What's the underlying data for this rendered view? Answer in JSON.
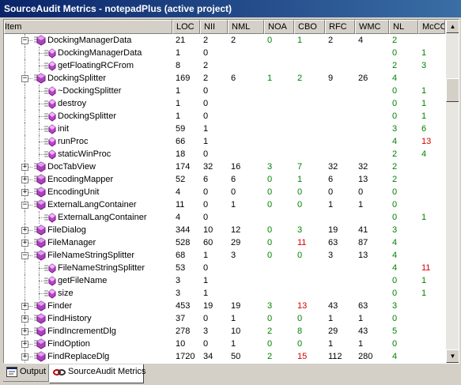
{
  "window": {
    "title": "SourceAudit Metrics - notepadPlus (active project)"
  },
  "columns": [
    "Item",
    "LOC",
    "NII",
    "NML",
    "NOA",
    "CBO",
    "RFC",
    "WMC",
    "NL",
    "McCC"
  ],
  "colors": {
    "good": "#008000",
    "bad": "#d00000",
    "title_start": "#0a246a",
    "title_end": "#3a6ea5"
  },
  "rows": [
    {
      "name": "DockingManagerData",
      "kind": "class",
      "expander": "-",
      "loc": "21",
      "nii": "2",
      "nml": "2",
      "noa": "0",
      "cbo": "1",
      "rfc": "2",
      "wmc": "4",
      "nl": "2",
      "mccc": ""
    },
    {
      "name": "DockingManagerData",
      "kind": "method",
      "expander": "",
      "loc": "1",
      "nii": "0",
      "nml": "",
      "noa": "",
      "cbo": "",
      "rfc": "",
      "wmc": "",
      "nl": "0",
      "mccc": "1"
    },
    {
      "name": "getFloatingRCFrom",
      "kind": "method",
      "expander": "",
      "loc": "8",
      "nii": "2",
      "nml": "",
      "noa": "",
      "cbo": "",
      "rfc": "",
      "wmc": "",
      "nl": "2",
      "mccc": "3"
    },
    {
      "name": "DockingSplitter",
      "kind": "class",
      "expander": "-",
      "loc": "169",
      "nii": "2",
      "nml": "6",
      "noa": "1",
      "cbo": "2",
      "rfc": "9",
      "wmc": "26",
      "nl": "4",
      "mccc": ""
    },
    {
      "name": "~DockingSplitter",
      "kind": "method",
      "expander": "",
      "loc": "1",
      "nii": "0",
      "nml": "",
      "noa": "",
      "cbo": "",
      "rfc": "",
      "wmc": "",
      "nl": "0",
      "mccc": "1"
    },
    {
      "name": "destroy",
      "kind": "method",
      "expander": "",
      "loc": "1",
      "nii": "0",
      "nml": "",
      "noa": "",
      "cbo": "",
      "rfc": "",
      "wmc": "",
      "nl": "0",
      "mccc": "1"
    },
    {
      "name": "DockingSplitter",
      "kind": "method",
      "expander": "",
      "loc": "1",
      "nii": "0",
      "nml": "",
      "noa": "",
      "cbo": "",
      "rfc": "",
      "wmc": "",
      "nl": "0",
      "mccc": "1"
    },
    {
      "name": "init",
      "kind": "method",
      "expander": "",
      "loc": "59",
      "nii": "1",
      "nml": "",
      "noa": "",
      "cbo": "",
      "rfc": "",
      "wmc": "",
      "nl": "3",
      "mccc": "6"
    },
    {
      "name": "runProc",
      "kind": "method",
      "expander": "",
      "loc": "66",
      "nii": "1",
      "nml": "",
      "noa": "",
      "cbo": "",
      "rfc": "",
      "wmc": "",
      "nl": "4",
      "mccc": "13"
    },
    {
      "name": "staticWinProc",
      "kind": "method",
      "expander": "",
      "loc": "18",
      "nii": "0",
      "nml": "",
      "noa": "",
      "cbo": "",
      "rfc": "",
      "wmc": "",
      "nl": "2",
      "mccc": "4"
    },
    {
      "name": "DocTabView",
      "kind": "class",
      "expander": "+",
      "loc": "174",
      "nii": "32",
      "nml": "16",
      "noa": "3",
      "cbo": "7",
      "rfc": "32",
      "wmc": "32",
      "nl": "2",
      "mccc": ""
    },
    {
      "name": "EncodingMapper",
      "kind": "class",
      "expander": "+",
      "loc": "52",
      "nii": "6",
      "nml": "6",
      "noa": "0",
      "cbo": "1",
      "rfc": "6",
      "wmc": "13",
      "nl": "2",
      "mccc": ""
    },
    {
      "name": "EncodingUnit",
      "kind": "class",
      "expander": "+",
      "loc": "4",
      "nii": "0",
      "nml": "0",
      "noa": "0",
      "cbo": "0",
      "rfc": "0",
      "wmc": "0",
      "nl": "0",
      "mccc": ""
    },
    {
      "name": "ExternalLangContainer",
      "kind": "class",
      "expander": "-",
      "loc": "11",
      "nii": "0",
      "nml": "1",
      "noa": "0",
      "cbo": "0",
      "rfc": "1",
      "wmc": "1",
      "nl": "0",
      "mccc": ""
    },
    {
      "name": "ExternalLangContainer",
      "kind": "method",
      "expander": "",
      "loc": "4",
      "nii": "0",
      "nml": "",
      "noa": "",
      "cbo": "",
      "rfc": "",
      "wmc": "",
      "nl": "0",
      "mccc": "1"
    },
    {
      "name": "FileDialog",
      "kind": "class",
      "expander": "+",
      "loc": "344",
      "nii": "10",
      "nml": "12",
      "noa": "0",
      "cbo": "3",
      "rfc": "19",
      "wmc": "41",
      "nl": "3",
      "mccc": ""
    },
    {
      "name": "FileManager",
      "kind": "class",
      "expander": "+",
      "loc": "528",
      "nii": "60",
      "nml": "29",
      "noa": "0",
      "cbo": "11",
      "rfc": "63",
      "wmc": "87",
      "nl": "4",
      "mccc": ""
    },
    {
      "name": "FileNameStringSplitter",
      "kind": "class",
      "expander": "-",
      "loc": "68",
      "nii": "1",
      "nml": "3",
      "noa": "0",
      "cbo": "0",
      "rfc": "3",
      "wmc": "13",
      "nl": "4",
      "mccc": ""
    },
    {
      "name": "FileNameStringSplitter",
      "kind": "method",
      "expander": "",
      "loc": "53",
      "nii": "0",
      "nml": "",
      "noa": "",
      "cbo": "",
      "rfc": "",
      "wmc": "",
      "nl": "4",
      "mccc": "11"
    },
    {
      "name": "getFileName",
      "kind": "method",
      "expander": "",
      "loc": "3",
      "nii": "1",
      "nml": "",
      "noa": "",
      "cbo": "",
      "rfc": "",
      "wmc": "",
      "nl": "0",
      "mccc": "1"
    },
    {
      "name": "size",
      "kind": "method",
      "expander": "",
      "loc": "3",
      "nii": "1",
      "nml": "",
      "noa": "",
      "cbo": "",
      "rfc": "",
      "wmc": "",
      "nl": "0",
      "mccc": "1"
    },
    {
      "name": "Finder",
      "kind": "class",
      "expander": "+",
      "loc": "453",
      "nii": "19",
      "nml": "19",
      "noa": "3",
      "cbo": "13",
      "rfc": "43",
      "wmc": "63",
      "nl": "3",
      "mccc": ""
    },
    {
      "name": "FindHistory",
      "kind": "class",
      "expander": "+",
      "loc": "37",
      "nii": "0",
      "nml": "1",
      "noa": "0",
      "cbo": "0",
      "rfc": "1",
      "wmc": "1",
      "nl": "0",
      "mccc": ""
    },
    {
      "name": "FindIncrementDlg",
      "kind": "class",
      "expander": "+",
      "loc": "278",
      "nii": "3",
      "nml": "10",
      "noa": "2",
      "cbo": "8",
      "rfc": "29",
      "wmc": "43",
      "nl": "5",
      "mccc": ""
    },
    {
      "name": "FindOption",
      "kind": "class",
      "expander": "+",
      "loc": "10",
      "nii": "0",
      "nml": "1",
      "noa": "0",
      "cbo": "0",
      "rfc": "1",
      "wmc": "1",
      "nl": "0",
      "mccc": ""
    },
    {
      "name": "FindReplaceDlg",
      "kind": "class",
      "expander": "+",
      "loc": "1720",
      "nii": "34",
      "nml": "50",
      "noa": "2",
      "cbo": "15",
      "rfc": "112",
      "wmc": "280",
      "nl": "4",
      "mccc": ""
    }
  ],
  "red_cells": {
    "8": [
      "mccc"
    ],
    "15": [],
    "16": [
      "cbo"
    ],
    "18": [
      "mccc"
    ],
    "21": [
      "cbo"
    ],
    "25": [
      "cbo"
    ]
  },
  "tabs": [
    {
      "label": "Output",
      "icon": "output-icon",
      "active": false
    },
    {
      "label": "SourceAudit Metrics",
      "icon": "metrics-icon",
      "active": true
    }
  ]
}
